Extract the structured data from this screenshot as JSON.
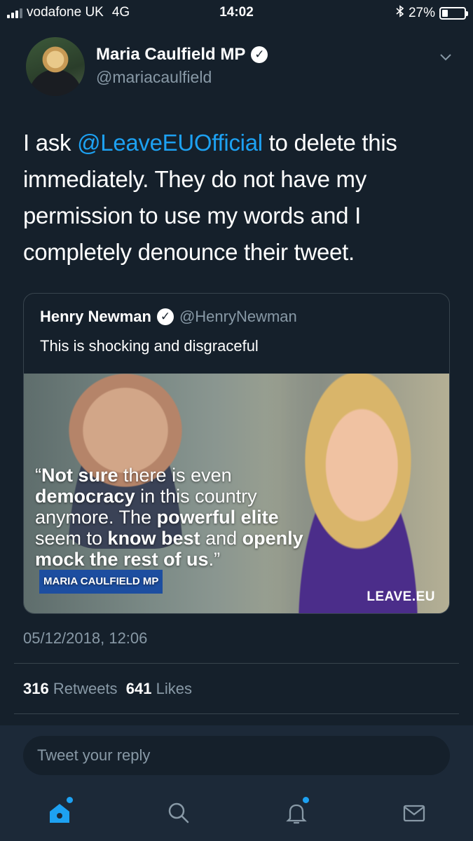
{
  "status_bar": {
    "carrier": "vodafone UK",
    "network": "4G",
    "time": "14:02",
    "battery_percent": "27%",
    "battery_level": 0.27
  },
  "tweet": {
    "author_name": "Maria Caulfield MP",
    "author_handle": "@mariacaulfield",
    "text_before": "I ask ",
    "mention": "@LeaveEUOfficial",
    "text_after": " to delete this immediately. They do not have my permission to use my words and I completely denounce their tweet.",
    "timestamp": "05/12/2018, 12:06",
    "retweets_count": "316",
    "retweets_label": "Retweets",
    "likes_count": "641",
    "likes_label": "Likes"
  },
  "quoted_tweet": {
    "author_name": "Henry Newman",
    "author_handle": "@HenryNewman",
    "text": "This is shocking and disgraceful",
    "image_text": {
      "open_quote": "“",
      "b1": "Not sure",
      "t1": " there is even ",
      "b2": "democracy",
      "t2": " in this country anymore. The ",
      "b3": "powerful elite",
      "t3": " seem to ",
      "b4": "know best",
      "t4": " and ",
      "b5": "openly mock the rest of us",
      "close_quote": ".”",
      "attribution": "MARIA CAULFIELD MP",
      "brand": "LEAVE.EU"
    }
  },
  "reply": {
    "placeholder": "Tweet your reply"
  },
  "tab_bar": {
    "items": [
      "home-icon",
      "search-icon",
      "notifications-icon",
      "messages-icon"
    ]
  },
  "colors": {
    "background": "#15202b",
    "accent": "#1da1f2",
    "secondary_text": "#8899a6",
    "border": "#38444d"
  }
}
